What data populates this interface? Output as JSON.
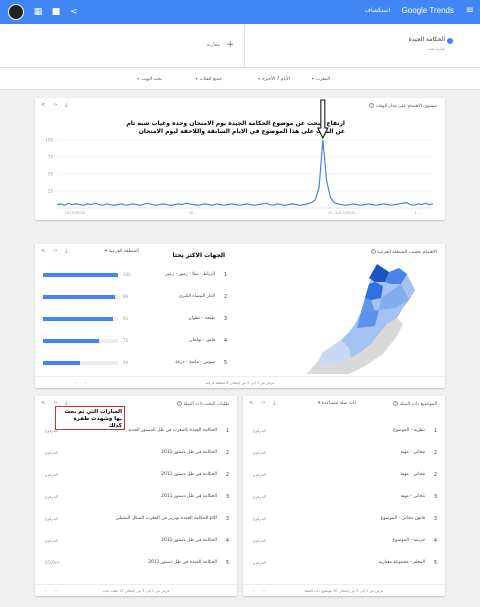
{
  "topbar": {
    "brand": "Google Trends",
    "explore": "استكشاف",
    "menu_icon": "menu-icon"
  },
  "compare": {
    "term_name": "الحكامة الجيدة",
    "term_sub": "عبارة بحث",
    "add_label": "+ مقارنة",
    "accent": "#4285f4"
  },
  "filters": {
    "country": "المغرب",
    "time": "الأيام 7 الأخيرة",
    "category": "جميع الفئات",
    "search_type": "بحث الويب"
  },
  "interest": {
    "title": "مستوى الاهتمام على مدار الوقت",
    "annotation": "ارتفاع البحث عن موضوع الحكامة الجيدة يوم الامتحان وحده وغياب شبه تام عن البحث على هذا الموضوع في الايام السابقة واللاحقة ليوم الامتحان",
    "y_ticks": [
      "100",
      "75",
      "50",
      "25"
    ],
    "x_labels": [
      "2017/05/28 ...",
      "30 ...",
      "31 ...",
      "2017/05/31 ...",
      "1 ..."
    ]
  },
  "chart_data": {
    "type": "line",
    "title": "مستوى الاهتمام على مدار الوقت",
    "ylim": [
      0,
      100
    ],
    "y_ticks": [
      25,
      50,
      75,
      100
    ],
    "x_tick_labels": [
      "2017/05/28 ...",
      "30 ...",
      "31 ...",
      "2017/05/31 ...",
      "1 ..."
    ],
    "series": [
      {
        "values": [
          5,
          6,
          4,
          7,
          5,
          6,
          5,
          4,
          6,
          5,
          7,
          5,
          4,
          6,
          5,
          4,
          5,
          6,
          4,
          5,
          6,
          5,
          4,
          6,
          7,
          5,
          4,
          5,
          6,
          5,
          4,
          5,
          6,
          5,
          7,
          6,
          5,
          4,
          5,
          6,
          5,
          4,
          6,
          5,
          4,
          5,
          6,
          5,
          4,
          5,
          6,
          5,
          4,
          5,
          6,
          7,
          5,
          4,
          6,
          5,
          4,
          5,
          6,
          5,
          4,
          5,
          6,
          8,
          12,
          30,
          100,
          40,
          15,
          8,
          6,
          5,
          4,
          5,
          6,
          5,
          4,
          5,
          6,
          5,
          4,
          5,
          6,
          5,
          4,
          5,
          6,
          7,
          8,
          5,
          4,
          6,
          5,
          7,
          5,
          6
        ]
      }
    ]
  },
  "regions_card": {
    "title": "الاهتمام بحسب المنطقة الفرعية",
    "annotation": "الجهات الاكثر بحثا",
    "selector": "المنطقة الفرعية",
    "rows": [
      {
        "rank": "1",
        "name": "الرباط - سلا - زمور - زعير",
        "value": "100",
        "fraction": 1.0
      },
      {
        "rank": "2",
        "name": "الدار البيضاء الكبرى",
        "value": "96",
        "fraction": 0.96
      },
      {
        "rank": "3",
        "name": "طنجة - تطوان",
        "value": "93",
        "fraction": 0.93
      },
      {
        "rank": "4",
        "name": "فاس - بولمان",
        "value": "75",
        "fraction": 0.75
      },
      {
        "rank": "5",
        "name": "سوس - ماسة - درعة",
        "value": "49",
        "fraction": 0.49
      }
    ],
    "footer": "عرض من 1 إلى 5 من إجمالي 8 منطقة فرعية"
  },
  "topics_card": {
    "title": "المواضيع ذات الصلة",
    "selector": "ذات صلة متصاعدة",
    "rows": [
      {
        "rank": "1",
        "name": "نظرية - الموضوع",
        "value": "المرفوع"
      },
      {
        "rank": "2",
        "name": "مجاني - مهنة",
        "value": "المرفوع"
      },
      {
        "rank": "2",
        "name": "مجاني - مهنة",
        "value": "المرفوع"
      },
      {
        "rank": "3",
        "name": "مجاني - مهنة",
        "value": "المرفوع"
      },
      {
        "rank": "3",
        "name": "قانون مجاني - الموضوع",
        "value": "المرفوع"
      },
      {
        "rank": "4",
        "name": "حريمة - الموضوع",
        "value": "المرفوع"
      },
      {
        "rank": "5",
        "name": "المعلم - مجموعة معيارية",
        "value": "المرفوع"
      }
    ],
    "footer": "عرض من 1 إلى 5 من إجمالي 10 موضوع ذات الصلة"
  },
  "queries_card": {
    "title": "طلبات البحث ذات الصلة",
    "selector": "ذات صلة متصاعدة",
    "annotation": "العبارات التي تم بحث بها وشهدت طفرة كذلك",
    "rows": [
      {
        "rank": "1",
        "name": "الحكامة الجيدة بالمغرب في ظل الدستور الجديد",
        "value": "المرفوع"
      },
      {
        "rank": "2",
        "name": "الحكامة في ظل دستور 2011",
        "value": "المرفوع"
      },
      {
        "rank": "2",
        "name": "الحكامة في ظل دستور 2011",
        "value": "المرفوع"
      },
      {
        "rank": "3",
        "name": "الحكامة في ظل دستور 2011",
        "value": "المرفوع"
      },
      {
        "rank": "3",
        "name": "الحكامة الجيدة بوبريز في المغرب الشكل التمثيلي pdf",
        "value": "المرفوع"
      },
      {
        "rank": "4",
        "name": "الحكامة في ظل دستور 2011",
        "value": "المرفوع"
      },
      {
        "rank": "5",
        "name": "الحكامة الجيدة في ظل دستور 2011",
        "value": "650%+"
      }
    ],
    "footer": "عرض من 1 إلى 5 من إجمالي 12 طلب بحث"
  },
  "actions": {
    "share_icon": "share-icon",
    "embed_icon": "embed-icon",
    "download_icon": "download-icon"
  }
}
